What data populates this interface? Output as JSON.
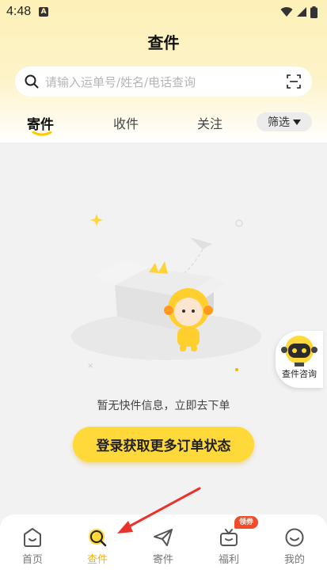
{
  "status_bar": {
    "time": "4:48",
    "notification_glyph": "A"
  },
  "header": {
    "title": "查件"
  },
  "search": {
    "placeholder": "请输入运单号/姓名/电话查询"
  },
  "tabs": [
    {
      "label": "寄件",
      "active": true
    },
    {
      "label": "收件",
      "active": false
    },
    {
      "label": "关注",
      "active": false
    }
  ],
  "filter": {
    "label": "筛选"
  },
  "empty_state": {
    "message": "暂无快件信息，立即去下单"
  },
  "login_button": {
    "label": "登录获取更多订单状态"
  },
  "float_widget": {
    "label": "查件咨询"
  },
  "bottom_nav": [
    {
      "label": "首页",
      "icon": "home-icon",
      "active": false
    },
    {
      "label": "查件",
      "icon": "search-icon",
      "active": true
    },
    {
      "label": "寄件",
      "icon": "send-icon",
      "active": false
    },
    {
      "label": "福利",
      "icon": "gift-icon",
      "active": false
    },
    {
      "label": "我的",
      "icon": "profile-icon",
      "active": false
    }
  ],
  "welfare_badge": "领券",
  "colors": {
    "accent": "#ffd83a",
    "active_text": "#f2b400",
    "badge": "#f24b2a",
    "annotation_arrow": "#e8322b"
  }
}
